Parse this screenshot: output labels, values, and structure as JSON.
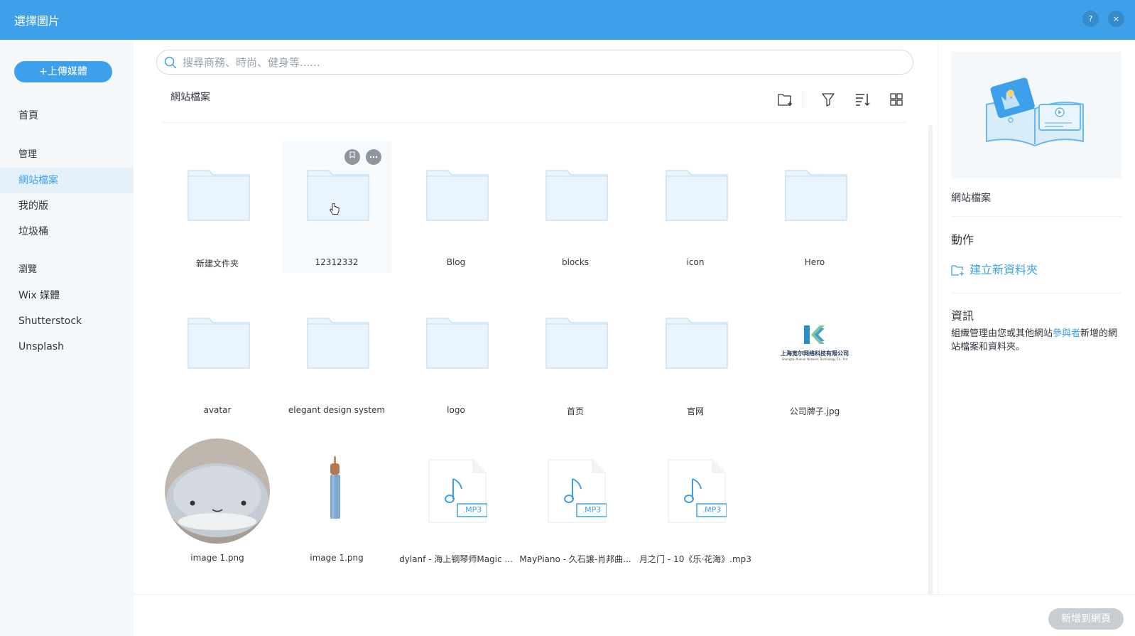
{
  "header": {
    "title": "選擇圖片",
    "help_label": "?",
    "close_label": "×"
  },
  "sidebar": {
    "upload_label": "+上傳媒體",
    "home": "首頁",
    "manage_heading": "管理",
    "manage_items": [
      "網站檔案",
      "我的版",
      "垃圾桶"
    ],
    "browse_heading": "瀏覽",
    "browse_items": [
      "Wix 媒體",
      "Shutterstock",
      "Unsplash"
    ]
  },
  "search": {
    "placeholder": "搜尋商務、時尚、健身等......",
    "value": ""
  },
  "breadcrumb": "網站檔案",
  "toolbar": {
    "icons": [
      "new-folder-icon",
      "filter-icon",
      "sort-icon",
      "grid-view-icon"
    ]
  },
  "tiles": {
    "row1": [
      "新建文件夹",
      "12312332",
      "Blog",
      "blocks",
      "icon",
      "Hero"
    ],
    "row2": [
      "avatar",
      "elegant design system",
      "logo",
      "首页",
      "官网",
      "公司牌子.jpg"
    ],
    "row3": [
      "image 1.png",
      "image 1.png",
      "dylanf - 海上钢琴师Magic ...",
      "MayPiano - 久石譲-肖邦曲...",
      "月之门 - 10《乐·花海》.mp3"
    ],
    "mp3_badge": ".MP3",
    "company_logo_text": "上海宽尔网络科技有限公司",
    "company_logo_subtext": "Shanghai Kuanar Network Technology Co., Ltd"
  },
  "right_panel": {
    "title": "網站檔案",
    "actions_heading": "動作",
    "create_folder": "建立新資料夾",
    "info_heading": "資訊",
    "info_text_before": "組織管理由您或其他網站",
    "info_link": "參與者",
    "info_text_after": "新增的網站檔案和資料夾。"
  },
  "footer": {
    "add_button": "新增到網頁"
  },
  "colors": {
    "accent": "#3ea0ea",
    "folder_fill": "#e9f4fc",
    "folder_stroke": "#c9e2f5",
    "sidebar_bg": "#f4f8fb"
  }
}
